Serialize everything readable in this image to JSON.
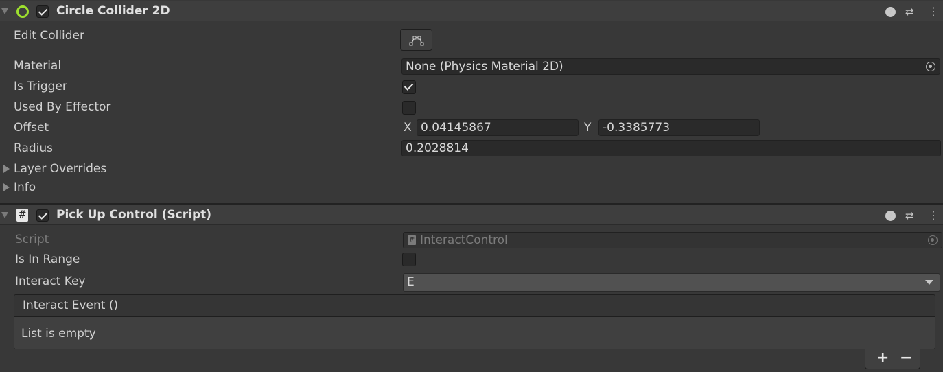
{
  "circle_collider": {
    "title": "Circle Collider 2D",
    "enabled": true,
    "edit_collider_label": "Edit Collider",
    "material_label": "Material",
    "material_value": "None (Physics Material 2D)",
    "is_trigger_label": "Is Trigger",
    "is_trigger": true,
    "used_by_effector_label": "Used By Effector",
    "used_by_effector": false,
    "offset_label": "Offset",
    "offset_x_label": "X",
    "offset_x": "0.04145867",
    "offset_y_label": "Y",
    "offset_y": "-0.3385773",
    "radius_label": "Radius",
    "radius_value": "0.2028814",
    "layer_overrides_label": "Layer Overrides",
    "info_label": "Info"
  },
  "pickup_control": {
    "title": "Pick Up Control (Script)",
    "enabled": true,
    "script_label": "Script",
    "script_value": "InteractControl",
    "is_in_range_label": "Is In Range",
    "is_in_range": false,
    "interact_key_label": "Interact Key",
    "interact_key_value": "E",
    "event_header": "Interact Event ()",
    "event_empty_text": "List is empty",
    "add_label": "+",
    "remove_label": "−"
  },
  "icons": {
    "help": "?",
    "presets": "⇄",
    "menu": "⋮",
    "script": "#"
  },
  "colors": {
    "background": "#383838",
    "header": "#3e3e3e",
    "field": "#2a2a2a",
    "collider_icon": "#9ee02e",
    "script_icon_bg": "#e8e8e8"
  }
}
